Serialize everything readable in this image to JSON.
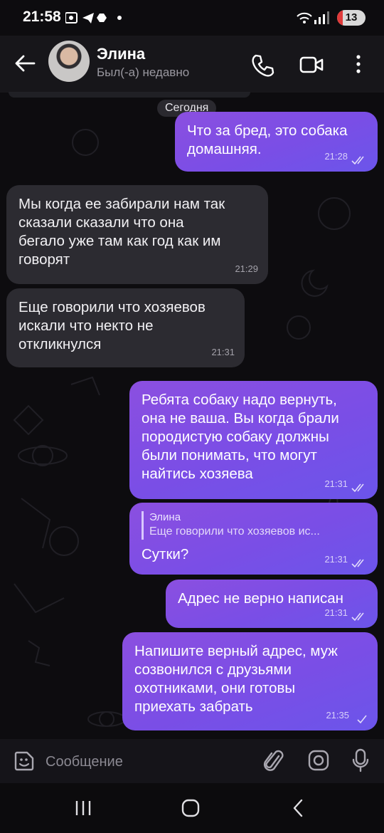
{
  "status_bar": {
    "time": "21:58",
    "battery": "13"
  },
  "header": {
    "contact_name": "Элина",
    "contact_status": "Был(-а) недавно"
  },
  "date_separator": "Сегодня",
  "messages": [
    {
      "direction": "out",
      "text": "Что за бред, это собака\nдомашняя.",
      "time": "21:28",
      "read": true
    },
    {
      "direction": "in",
      "text": "Мы когда ее забирали нам так\nсказали сказали что она\nбегало уже там как год как им\nговорят",
      "time": "21:29"
    },
    {
      "direction": "in",
      "text": "Еще говорили что хозяевов\nискали что некто не\nоткликнулся",
      "time": "21:31"
    },
    {
      "direction": "out",
      "text": "Ребята собаку надо вернуть,\nона не ваша. Вы когда брали\nпородистую собаку должны\nбыли понимать, что могут\nнайтись хозяева",
      "time": "21:31",
      "read": true
    },
    {
      "direction": "out",
      "reply_name": "Элина",
      "reply_text": "Еще говорили что хозяевов ис...",
      "text": "Сутки?",
      "time": "21:31",
      "read": true
    },
    {
      "direction": "out",
      "text": "Адрес не верно написан",
      "time": "21:31",
      "read": true
    },
    {
      "direction": "out",
      "text": "Напишите верный адрес, муж\nсозвонился с друзьями\nохотниками, они готовы\nприехать забрать",
      "time": "21:35",
      "read": false
    }
  ],
  "input": {
    "placeholder": "Сообщение"
  },
  "colors": {
    "bubble_out_start": "#8b4fe0",
    "bubble_out_end": "#6b55ea",
    "bubble_in": "#2c2b31",
    "background": "#0d0c0f"
  }
}
